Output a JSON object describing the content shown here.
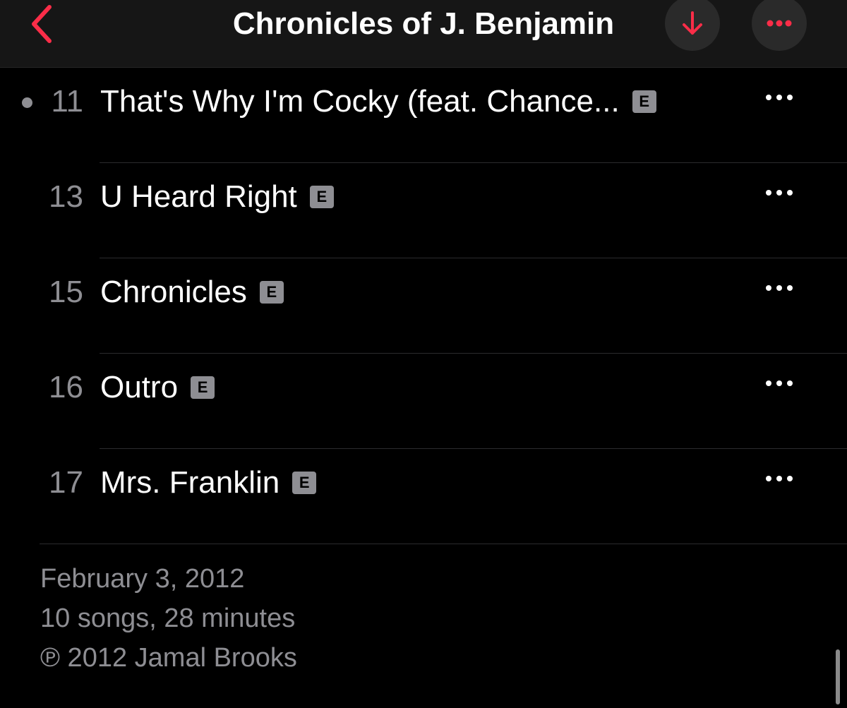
{
  "nav": {
    "title": "Chronicles of J. Benjamin",
    "back_icon": "chevron-left-icon",
    "download_icon": "arrow-down-icon",
    "more_icon": "ellipsis-icon"
  },
  "colors": {
    "accent": "#fa2d48",
    "background": "#000000",
    "nav_background": "#161616",
    "secondary_text": "#8e8e93"
  },
  "tracks": [
    {
      "number": "11",
      "title": "That's Why I'm Cocky (feat. Chance...",
      "explicit": "E",
      "now_playing": true
    },
    {
      "number": "13",
      "title": "U Heard Right",
      "explicit": "E",
      "now_playing": false
    },
    {
      "number": "15",
      "title": "Chronicles",
      "explicit": "E",
      "now_playing": false
    },
    {
      "number": "16",
      "title": "Outro",
      "explicit": "E",
      "now_playing": false
    },
    {
      "number": "17",
      "title": "Mrs. Franklin",
      "explicit": "E",
      "now_playing": false
    }
  ],
  "footer": {
    "release_date": "February 3, 2012",
    "summary": "10 songs, 28 minutes",
    "copyright": "℗ 2012 Jamal Brooks"
  }
}
